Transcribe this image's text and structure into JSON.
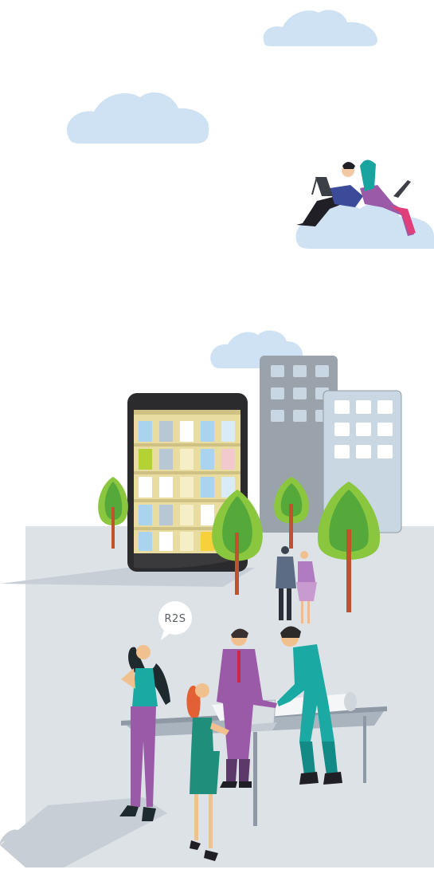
{
  "speech_bubble": {
    "text": "R2S"
  },
  "colors": {
    "cloud": "#cfe2f3",
    "plaza": "#dde2e7",
    "plaza_shadow": "#c8ced5",
    "building_gray": "#9aa3ab",
    "building_light": "#c9d7e2",
    "tablet_body": "#2b2b2d",
    "tree_light": "#8bc63f",
    "tree_dark": "#55a83a",
    "trunk": "#c0532b",
    "teal": "#1aa9a3",
    "purple": "#9a5aa8"
  }
}
